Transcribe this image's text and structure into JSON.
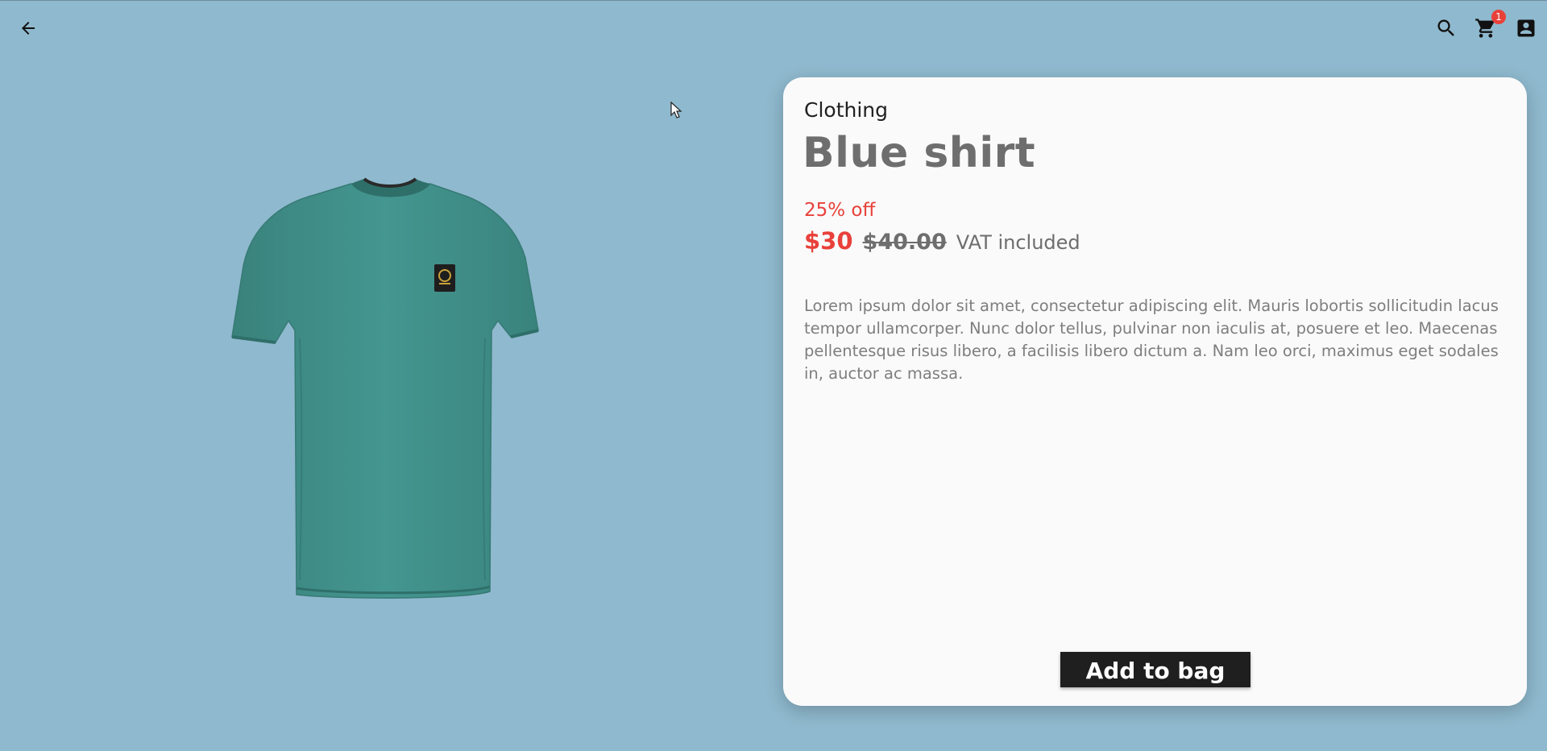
{
  "appbar": {
    "back_icon": "arrow-back-icon",
    "search_icon": "search-icon",
    "cart_icon": "shopping-cart-icon",
    "cart_count": "1",
    "account_icon": "account-box-icon"
  },
  "product": {
    "image_icon": "tshirt-image",
    "category": "Clothing",
    "title": "Blue shirt",
    "discount": "25% off",
    "price": "$30",
    "old_price": "$40.00",
    "vat": "VAT included",
    "description": "Lorem ipsum dolor sit amet, consectetur adipiscing elit. Mauris lobortis sollicitudin lacus tempor ullamcorper. Nunc dolor tellus, pulvinar non iaculis at, posuere et leo. Maecenas pellentesque risus libero, a facilisis libero dictum a. Nam leo orci, maximus eget sodales in, auctor ac massa.",
    "add_button_label": "Add to bag"
  },
  "colors": {
    "background": "#8fb9ce",
    "accent_red": "#e8413a",
    "shirt": "#3f8c86",
    "card": "#fafafa",
    "button": "#1f1f1f"
  }
}
